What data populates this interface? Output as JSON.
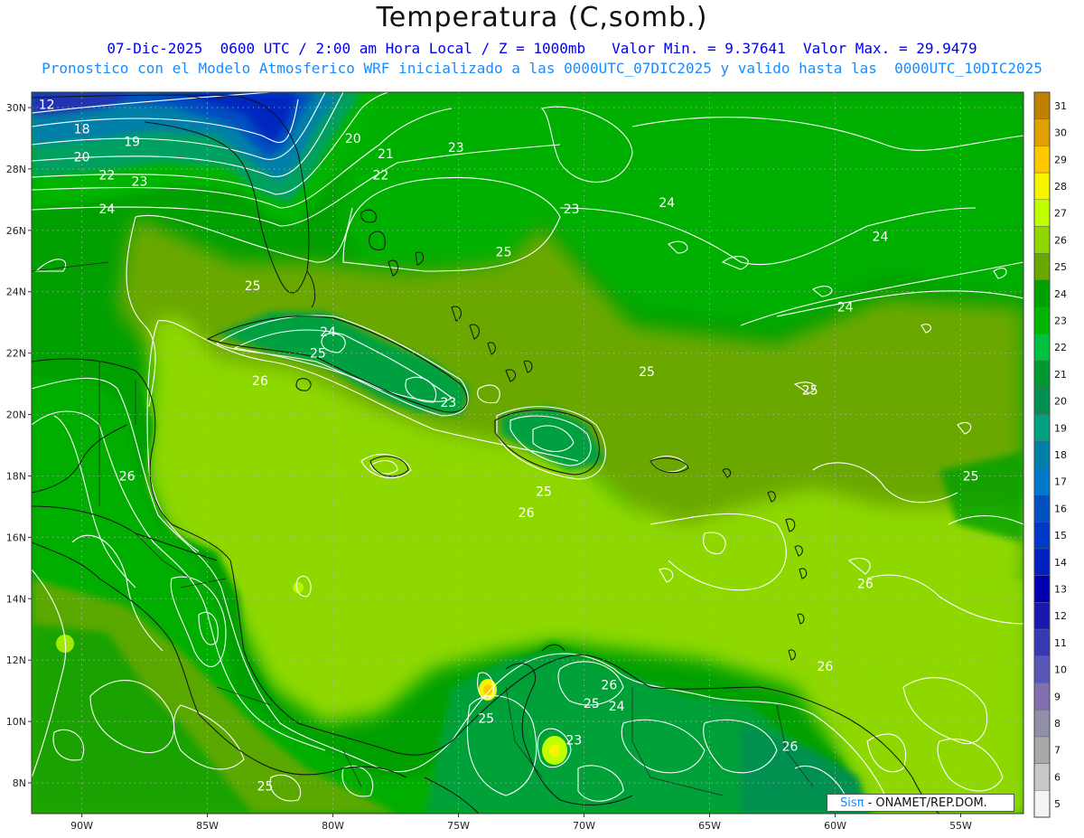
{
  "header": {
    "title": "Temperatura (C,somb.)",
    "subtitle_1": "07-Dic-2025  0600 UTC / 2:00 am Hora Local / Z = 1000mb   Valor Min. = 9.37641  Valor Max. = 29.9479",
    "subtitle_2": "Pronostico con el Modelo Atmosferico WRF inicializado a las 0000UTC_07DIC2025 y valido hasta las  0000UTC_10DIC2025"
  },
  "map": {
    "lon_range": [
      -92.0,
      -52.5
    ],
    "lat_range": [
      7.0,
      30.5
    ],
    "lat_ticks": [
      {
        "value": 30,
        "label": "30N"
      },
      {
        "value": 28,
        "label": "28N"
      },
      {
        "value": 26,
        "label": "26N"
      },
      {
        "value": 24,
        "label": "24N"
      },
      {
        "value": 22,
        "label": "22N"
      },
      {
        "value": 20,
        "label": "20N"
      },
      {
        "value": 18,
        "label": "18N"
      },
      {
        "value": 16,
        "label": "16N"
      },
      {
        "value": 14,
        "label": "14N"
      },
      {
        "value": 12,
        "label": "12N"
      },
      {
        "value": 10,
        "label": "10N"
      },
      {
        "value": 8,
        "label": "8N"
      }
    ],
    "lon_ticks": [
      {
        "value": -90,
        "label": "90W"
      },
      {
        "value": -85,
        "label": "85W"
      },
      {
        "value": -80,
        "label": "80W"
      },
      {
        "value": -75,
        "label": "75W"
      },
      {
        "value": -70,
        "label": "70W"
      },
      {
        "value": -65,
        "label": "65W"
      },
      {
        "value": -60,
        "label": "60W"
      },
      {
        "value": -55,
        "label": "55W"
      }
    ],
    "contour_labels": [
      {
        "text": "12",
        "lon": -91.4,
        "lat": 30.1
      },
      {
        "text": "18",
        "lon": -90.0,
        "lat": 29.3
      },
      {
        "text": "19",
        "lon": -88.0,
        "lat": 28.9
      },
      {
        "text": "20",
        "lon": -90.0,
        "lat": 28.4
      },
      {
        "text": "22",
        "lon": -89.0,
        "lat": 27.8
      },
      {
        "text": "23",
        "lon": -87.7,
        "lat": 27.6
      },
      {
        "text": "24",
        "lon": -89.0,
        "lat": 26.7
      },
      {
        "text": "20",
        "lon": -79.2,
        "lat": 29.0
      },
      {
        "text": "21",
        "lon": -77.9,
        "lat": 28.5
      },
      {
        "text": "22",
        "lon": -78.1,
        "lat": 27.8
      },
      {
        "text": "23",
        "lon": -75.1,
        "lat": 28.7
      },
      {
        "text": "23",
        "lon": -70.5,
        "lat": 26.7
      },
      {
        "text": "24",
        "lon": -66.7,
        "lat": 26.9
      },
      {
        "text": "24",
        "lon": -58.2,
        "lat": 25.8
      },
      {
        "text": "25",
        "lon": -73.2,
        "lat": 25.3
      },
      {
        "text": "25",
        "lon": -83.2,
        "lat": 24.2
      },
      {
        "text": "24",
        "lon": -80.2,
        "lat": 22.7
      },
      {
        "text": "25",
        "lon": -80.6,
        "lat": 22.0
      },
      {
        "text": "26",
        "lon": -82.9,
        "lat": 21.1
      },
      {
        "text": "25",
        "lon": -67.5,
        "lat": 21.4
      },
      {
        "text": "25",
        "lon": -61.0,
        "lat": 20.8
      },
      {
        "text": "24",
        "lon": -59.6,
        "lat": 23.5
      },
      {
        "text": "23",
        "lon": -75.4,
        "lat": 20.4
      },
      {
        "text": "26",
        "lon": -88.2,
        "lat": 18.0
      },
      {
        "text": "25",
        "lon": -71.6,
        "lat": 17.5
      },
      {
        "text": "26",
        "lon": -72.3,
        "lat": 16.8
      },
      {
        "text": "25",
        "lon": -54.6,
        "lat": 18.0
      },
      {
        "text": "26",
        "lon": -58.8,
        "lat": 14.5
      },
      {
        "text": "26",
        "lon": -60.4,
        "lat": 11.8
      },
      {
        "text": "26",
        "lon": -69.0,
        "lat": 11.2
      },
      {
        "text": "25",
        "lon": -69.7,
        "lat": 10.6
      },
      {
        "text": "24",
        "lon": -68.7,
        "lat": 10.5
      },
      {
        "text": "25",
        "lon": -73.9,
        "lat": 10.1
      },
      {
        "text": "23",
        "lon": -70.4,
        "lat": 9.4
      },
      {
        "text": "26",
        "lon": -61.8,
        "lat": 9.2
      },
      {
        "text": "25",
        "lon": -82.7,
        "lat": 7.9
      }
    ]
  },
  "colorbar": {
    "levels": [
      {
        "label": "31",
        "color": "#c08000"
      },
      {
        "label": "30",
        "color": "#e0a000"
      },
      {
        "label": "29",
        "color": "#ffc800"
      },
      {
        "label": "28",
        "color": "#f5f500"
      },
      {
        "label": "27",
        "color": "#c0ff00"
      },
      {
        "label": "26",
        "color": "#8ed800"
      },
      {
        "label": "25",
        "color": "#6aa800"
      },
      {
        "label": "24",
        "color": "#00a000"
      },
      {
        "label": "23",
        "color": "#00b400"
      },
      {
        "label": "22",
        "color": "#00c040"
      },
      {
        "label": "21",
        "color": "#009830"
      },
      {
        "label": "20",
        "color": "#009050"
      },
      {
        "label": "19",
        "color": "#00a080"
      },
      {
        "label": "18",
        "color": "#0080a8"
      },
      {
        "label": "17",
        "color": "#0078c8"
      },
      {
        "label": "16",
        "color": "#0050c0"
      },
      {
        "label": "15",
        "color": "#0038c8"
      },
      {
        "label": "14",
        "color": "#0020c0"
      },
      {
        "label": "13",
        "color": "#0000b0"
      },
      {
        "label": "12",
        "color": "#1818b0"
      },
      {
        "label": "11",
        "color": "#3838b0"
      },
      {
        "label": "10",
        "color": "#5858b8"
      },
      {
        "label": "9",
        "color": "#8070b0"
      },
      {
        "label": "8",
        "color": "#9090a8"
      },
      {
        "label": "7",
        "color": "#a8a8a8"
      },
      {
        "label": "6",
        "color": "#c8c8c8"
      },
      {
        "label": "5",
        "color": "#f4f4f4"
      }
    ]
  },
  "credit": {
    "brand": "Sisπ",
    "org": " - ONAMET/REP.DOM."
  }
}
